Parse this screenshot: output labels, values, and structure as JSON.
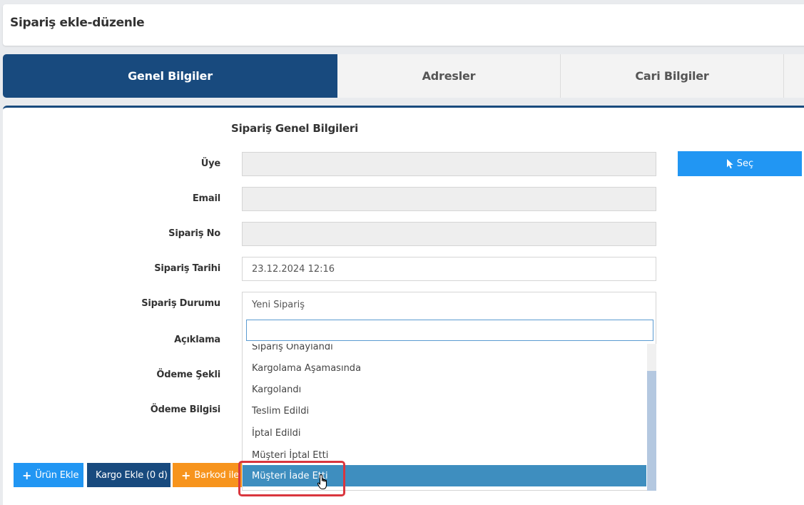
{
  "header": {
    "title": "Sipariş ekle-düzenle"
  },
  "tabs": [
    {
      "label": "Genel Bilgiler",
      "active": true
    },
    {
      "label": "Adresler",
      "active": false
    },
    {
      "label": "Cari Bilgiler",
      "active": false
    }
  ],
  "section": {
    "title": "Sipariş Genel Bilgileri"
  },
  "form": {
    "uye": {
      "label": "Üye",
      "value": ""
    },
    "email": {
      "label": "Email",
      "value": ""
    },
    "siparis_no": {
      "label": "Sipariş No",
      "value": ""
    },
    "siparis_tarihi": {
      "label": "Sipariş Tarihi",
      "value": "23.12.2024 12:16"
    },
    "siparis_durumu": {
      "label": "Sipariş Durumu",
      "value": "Yeni Sipariş"
    },
    "aciklama": {
      "label": "Açıklama"
    },
    "odeme_sekli": {
      "label": "Ödeme Şekli"
    },
    "odeme_bilgisi": {
      "label": "Ödeme Bilgisi"
    }
  },
  "sec_button": {
    "label": "Seç",
    "icon": "cursor-arrow-icon"
  },
  "dropdown": {
    "search_value": "",
    "options": [
      "Sipariş Onaylandı",
      "Kargolama Aşamasında",
      "Kargolandı",
      "Teslim Edildi",
      "İptal Edildi",
      "Müşteri İptal Etti",
      "Müşteri İade Etti"
    ],
    "highlighted": "Müşteri İade Etti"
  },
  "actions": {
    "urun_ekle": "Ürün Ekle",
    "kargo_ekle": "Kargo Ekle (0 d)",
    "barkod": "Barkod ile"
  },
  "colors": {
    "primary_dark": "#184a7e",
    "sec_blue": "#2196f3",
    "action_blue": "#2196f3",
    "action_orange": "#f7941d",
    "highlight_blue": "#3e8ebf",
    "annotation_red": "#d9363e"
  }
}
